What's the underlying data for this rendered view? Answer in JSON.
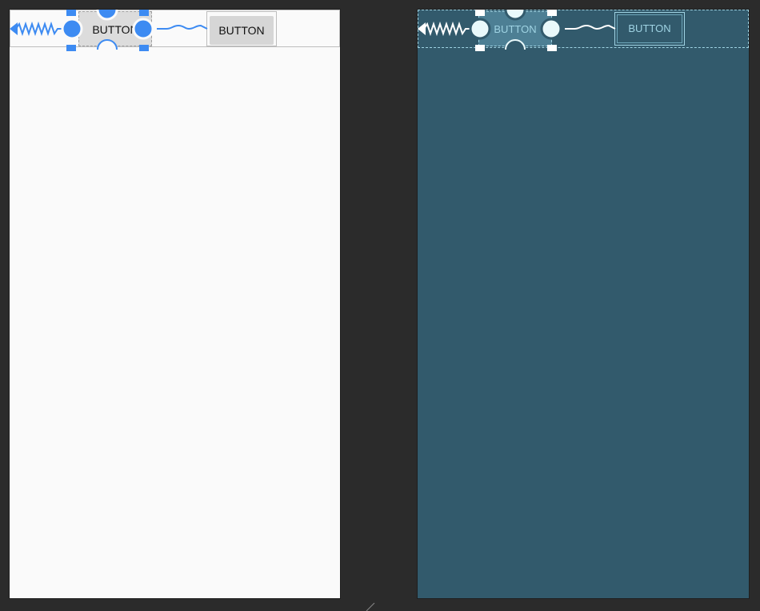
{
  "design_view": {
    "selected_button_label": "BUTTON",
    "second_button_label": "BUTTON"
  },
  "blueprint_view": {
    "selected_button_label": "BUTTON",
    "second_button_label": "BUTTON"
  },
  "colors": {
    "workspace_background": "#2b2b2b",
    "design_surface": "#fafafa",
    "blueprint_surface": "#325a6c",
    "selection_accent": "#3d8bf2",
    "blueprint_outline": "#9fd3e3"
  },
  "icons": {
    "anchor": "left-anchor-arrow-icon",
    "spring_constraint": "zigzag-spring-icon",
    "chain_constraint": "wavy-chain-icon",
    "handle": "constraint-handle-icon"
  }
}
